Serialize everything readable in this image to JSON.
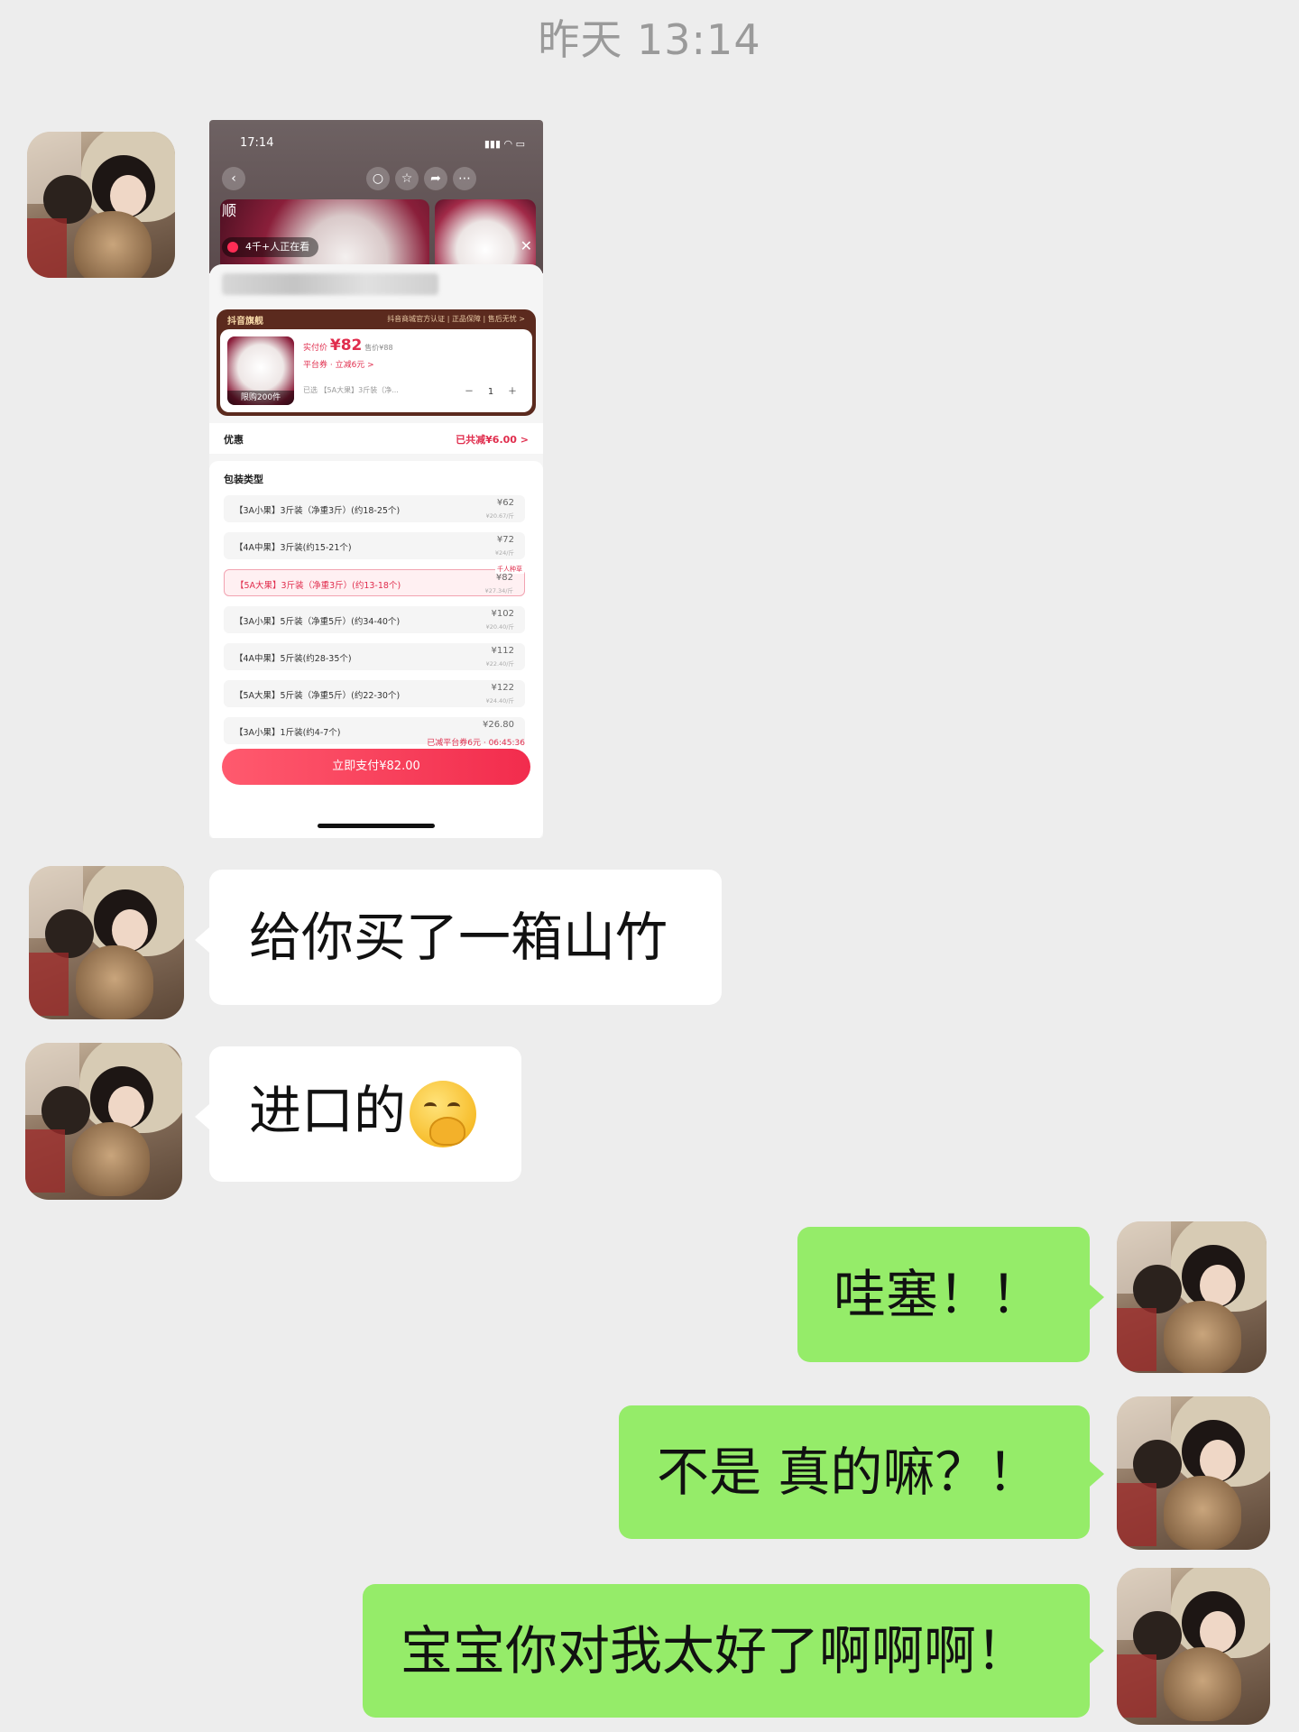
{
  "header": {
    "timestamp": "昨天 13:14"
  },
  "messages": [
    {
      "side": "left",
      "type": "image"
    },
    {
      "side": "left",
      "type": "text",
      "text": "给你买了一箱山竹"
    },
    {
      "side": "left",
      "type": "text",
      "text": "进口的",
      "emoji": "hand-over-mouth-emoji"
    },
    {
      "side": "right",
      "type": "text",
      "text": "哇塞！！"
    },
    {
      "side": "right",
      "type": "text",
      "text": "不是 真的嘛？！"
    },
    {
      "side": "right",
      "type": "text",
      "text": "宝宝你对我太好了啊啊啊！"
    }
  ],
  "screenshot": {
    "time": "17:14",
    "shop_name": "顺",
    "viewers": "4千+人正在看",
    "brand": "抖音旗舰",
    "certification": "抖音商城官方认证 | 正品保障 | 售后无忧 >",
    "pay_label": "实付价",
    "pay_price": "¥82",
    "orig_price": "售价¥88",
    "coupon": "平台券 · 立减6元 >",
    "limit": "限购200件",
    "selected": "已选 【5A大果】3斤装（净...",
    "qty_minus": "－",
    "qty": "1",
    "qty_plus": "＋",
    "discount_label": "优惠",
    "discount_value": "已共减¥6.00 >",
    "options_title": "包装类型",
    "options": [
      {
        "name": "【3A小果】3斤装（净重3斤）(约18-25个)",
        "price": "¥62",
        "unit": "¥20.67/斤"
      },
      {
        "name": "【4A中果】3斤装(约15-21个)",
        "price": "¥72",
        "unit": "¥24/斤"
      },
      {
        "name": "【5A大果】3斤装（净重3斤）(约13-18个)",
        "price": "¥82",
        "unit": "¥27.34/斤",
        "hot": "千人种草",
        "selected": true
      },
      {
        "name": "【3A小果】5斤装（净重5斤）(约34-40个)",
        "price": "¥102",
        "unit": "¥20.40/斤"
      },
      {
        "name": "【4A中果】5斤装(约28-35个)",
        "price": "¥112",
        "unit": "¥22.40/斤"
      },
      {
        "name": "【5A大果】5斤装（净重5斤）(约22-30个)",
        "price": "¥122",
        "unit": "¥24.40/斤"
      },
      {
        "name": "【3A小果】1斤装(约4-7个)",
        "price": "¥26.80",
        "unit": ""
      }
    ],
    "countdown": "已减平台券6元 · 06:45:36",
    "pay_button": "立即支付¥82.00"
  },
  "colors": {
    "chat_bg": "#ededed",
    "right_bubble": "#95ec69",
    "left_bubble": "#ffffff",
    "accent": "#e02d4d"
  }
}
